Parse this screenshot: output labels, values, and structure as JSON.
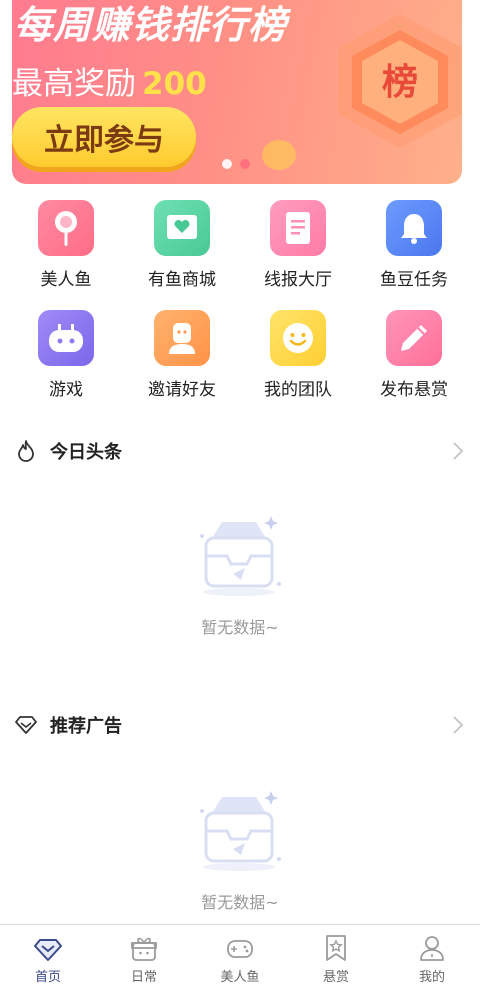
{
  "banner": {
    "title": "每周赚钱排行榜",
    "reward_prefix": "最高奖励",
    "reward_value": "200",
    "cta": "立即参与",
    "badge": "榜",
    "slides": 2,
    "active_slide": 2
  },
  "grid": [
    {
      "label": "美人鱼",
      "icon": "lollipop-icon",
      "color": "#ff7e97"
    },
    {
      "label": "有鱼商城",
      "icon": "heart-frame-icon",
      "color": "#5fd8a7"
    },
    {
      "label": "线报大厅",
      "icon": "document-icon",
      "color": "#ff8eb3"
    },
    {
      "label": "鱼豆任务",
      "icon": "bell-icon",
      "color": "#5c8bf5"
    },
    {
      "label": "游戏",
      "icon": "gamepad-icon",
      "color": "#8e7bf0"
    },
    {
      "label": "邀请好友",
      "icon": "person-icon",
      "color": "#ffa45c"
    },
    {
      "label": "我的团队",
      "icon": "smiley-icon",
      "color": "#ffd94a"
    },
    {
      "label": "发布悬赏",
      "icon": "pencil-icon",
      "color": "#ff7fa6"
    }
  ],
  "sections": {
    "headlines": {
      "title": "今日头条",
      "empty_text": "暂无数据~"
    },
    "ads": {
      "title": "推荐广告",
      "empty_text": "暂无数据~"
    }
  },
  "tabs": [
    {
      "label": "首页",
      "icon": "home-diamond-icon",
      "active": true
    },
    {
      "label": "日常",
      "icon": "gift-box-icon",
      "active": false
    },
    {
      "label": "美人鱼",
      "icon": "game-controller-icon",
      "active": false
    },
    {
      "label": "悬赏",
      "icon": "star-badge-icon",
      "active": false
    },
    {
      "label": "我的",
      "icon": "user-icon",
      "active": false
    }
  ],
  "colors": {
    "accent": "#3a4a8c",
    "banner_cta": "#ffd53d",
    "reward_number": "#ffe14a"
  }
}
